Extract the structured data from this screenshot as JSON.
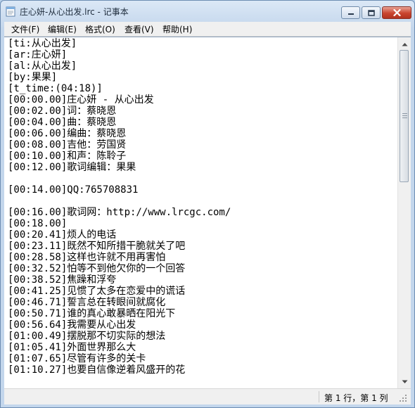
{
  "window": {
    "title": "庄心妍-从心出发.lrc - 记事本"
  },
  "menu": {
    "items": [
      {
        "label": "文件(F)"
      },
      {
        "label": "编辑(E)"
      },
      {
        "label": "格式(O)"
      },
      {
        "label": "查看(V)"
      },
      {
        "label": "帮助(H)"
      }
    ]
  },
  "editor": {
    "lines": [
      "[ti:从心出发]",
      "[ar:庄心妍]",
      "[al:从心出发]",
      "[by:果果]",
      "[t_time:(04:18)]",
      "[00:00.00]庄心妍 - 从心出发",
      "[00:02.00]词：蔡晓恩",
      "[00:04.00]曲：蔡晓恩",
      "[00:06.00]编曲：蔡晓恩",
      "[00:08.00]吉他：劳国贤",
      "[00:10.00]和声：陈聆子",
      "[00:12.00]歌词编辑：果果",
      "",
      "[00:14.00]QQ:765708831",
      "",
      "[00:16.00]歌词网：http://www.lrcgc.com/",
      "[00:18.00]",
      "[00:20.41]烦人的电话",
      "[00:23.11]既然不知所措干脆就关了吧",
      "[00:28.58]这样也许就不用再害怕",
      "[00:32.52]怕等不到他欠你的一个回答",
      "[00:38.52]焦躁和浮夸",
      "[00:41.25]见惯了太多在恋爱中的谎话",
      "[00:46.71]誓言总在转眼间就腐化",
      "[00:50.71]谁的真心敢暴晒在阳光下",
      "[00:56.64]我需要从心出发",
      "[01:00.49]摆脱那不切实际的想法",
      "[01:05.41]外面世界那么大",
      "[01:07.65]尽管有许多的关卡",
      "[01:10.27]也要自信像逆着风盛开的花"
    ]
  },
  "status": {
    "position": "第 1 行，第 1 列"
  }
}
